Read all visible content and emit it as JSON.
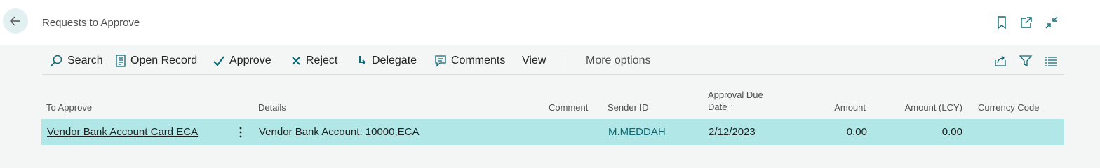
{
  "header": {
    "title": "Requests to Approve",
    "icons": [
      "back-arrow-icon",
      "bookmark-icon",
      "open-new-window-icon",
      "collapse-icon"
    ]
  },
  "toolbar": {
    "search": "Search",
    "open_record": "Open Record",
    "approve": "Approve",
    "reject": "Reject",
    "delegate": "Delegate",
    "comments": "Comments",
    "view": "View",
    "more_options": "More options",
    "right_icons": [
      "share-icon",
      "filter-icon",
      "list-view-icon"
    ]
  },
  "table": {
    "columns": {
      "to_approve": "To Approve",
      "details": "Details",
      "comment": "Comment",
      "sender_id": "Sender ID",
      "due_date_line1": "Approval Due",
      "due_date_line2": "Date",
      "sort_indicator": "↑",
      "amount": "Amount",
      "amount_lcy": "Amount (LCY)",
      "currency_code": "Currency Code"
    },
    "rows": [
      {
        "to_approve": "Vendor Bank Account Card ECA",
        "details": "Vendor Bank Account: 10000,ECA",
        "comment": "",
        "sender_id": "M.MEDDAH",
        "due_date": "2/12/2023",
        "amount": "0.00",
        "amount_lcy": "0.00",
        "currency_code": ""
      }
    ]
  },
  "colors": {
    "accent": "#0b6a75",
    "selected_row": "#b2e7e7",
    "back_button_bg": "#e2f0f2"
  }
}
